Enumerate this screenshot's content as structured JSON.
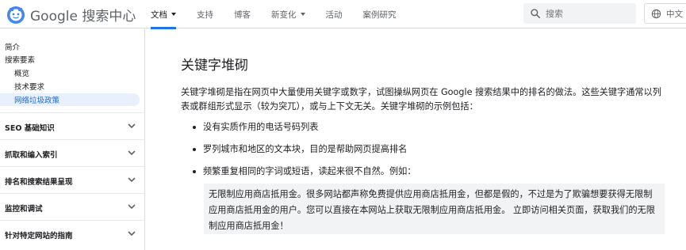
{
  "header": {
    "logo_text": "Google 搜索中心",
    "nav": [
      {
        "label": "文档",
        "dropdown": true,
        "active": true
      },
      {
        "label": "支持",
        "dropdown": false,
        "active": false
      },
      {
        "label": "博客",
        "dropdown": false,
        "active": false
      },
      {
        "label": "新变化",
        "dropdown": true,
        "active": false
      },
      {
        "label": "活动",
        "dropdown": false,
        "active": false
      },
      {
        "label": "案例研究",
        "dropdown": false,
        "active": false
      }
    ],
    "search_placeholder": "搜索",
    "language_label": "中文"
  },
  "sidebar": {
    "items": [
      {
        "label": "简介"
      },
      {
        "label": "搜索要素"
      }
    ],
    "children": [
      {
        "label": "概览"
      },
      {
        "label": "技术要求"
      },
      {
        "label": "网络垃圾政策",
        "active": true
      }
    ],
    "sections": [
      {
        "label": "SEO 基础知识"
      },
      {
        "label": "抓取和编入索引"
      },
      {
        "label": "排名和搜索结果呈现"
      },
      {
        "label": "监控和调试"
      },
      {
        "label": "针对特定网站的指南"
      }
    ]
  },
  "main": {
    "title": "关键字堆砌",
    "intro": "关键字堆砌是指在网页中大量使用关键字或数字，试图操纵网页在 Google 搜索结果中的排名的做法。这些关键字通常以列表或群组形式显示（较为突兀），或与上下文无关。关键字堆砌的示例包括：",
    "bullets": [
      "没有实质作用的电话号码列表",
      "罗列城市和地区的文本块，目的是帮助网页提高排名",
      "频繁重复相同的字词或短语，读起来很不自然。例如："
    ],
    "quote": "无限制应用商店抵用金。很多网站都声称免费提供应用商店抵用金，但都是假的，不过是为了欺骗想要获得无限制应用商店抵用金的用户。您可以直接在本网站上获取无限制应用商店抵用金。 立即访问相关页面，获取我们的无限制应用商店抵用金！"
  },
  "colors": {
    "accent": "#1a73e8",
    "active_bg": "#e8f0fe",
    "active_text": "#1967d2",
    "quote_bg": "#f1f3f4"
  }
}
